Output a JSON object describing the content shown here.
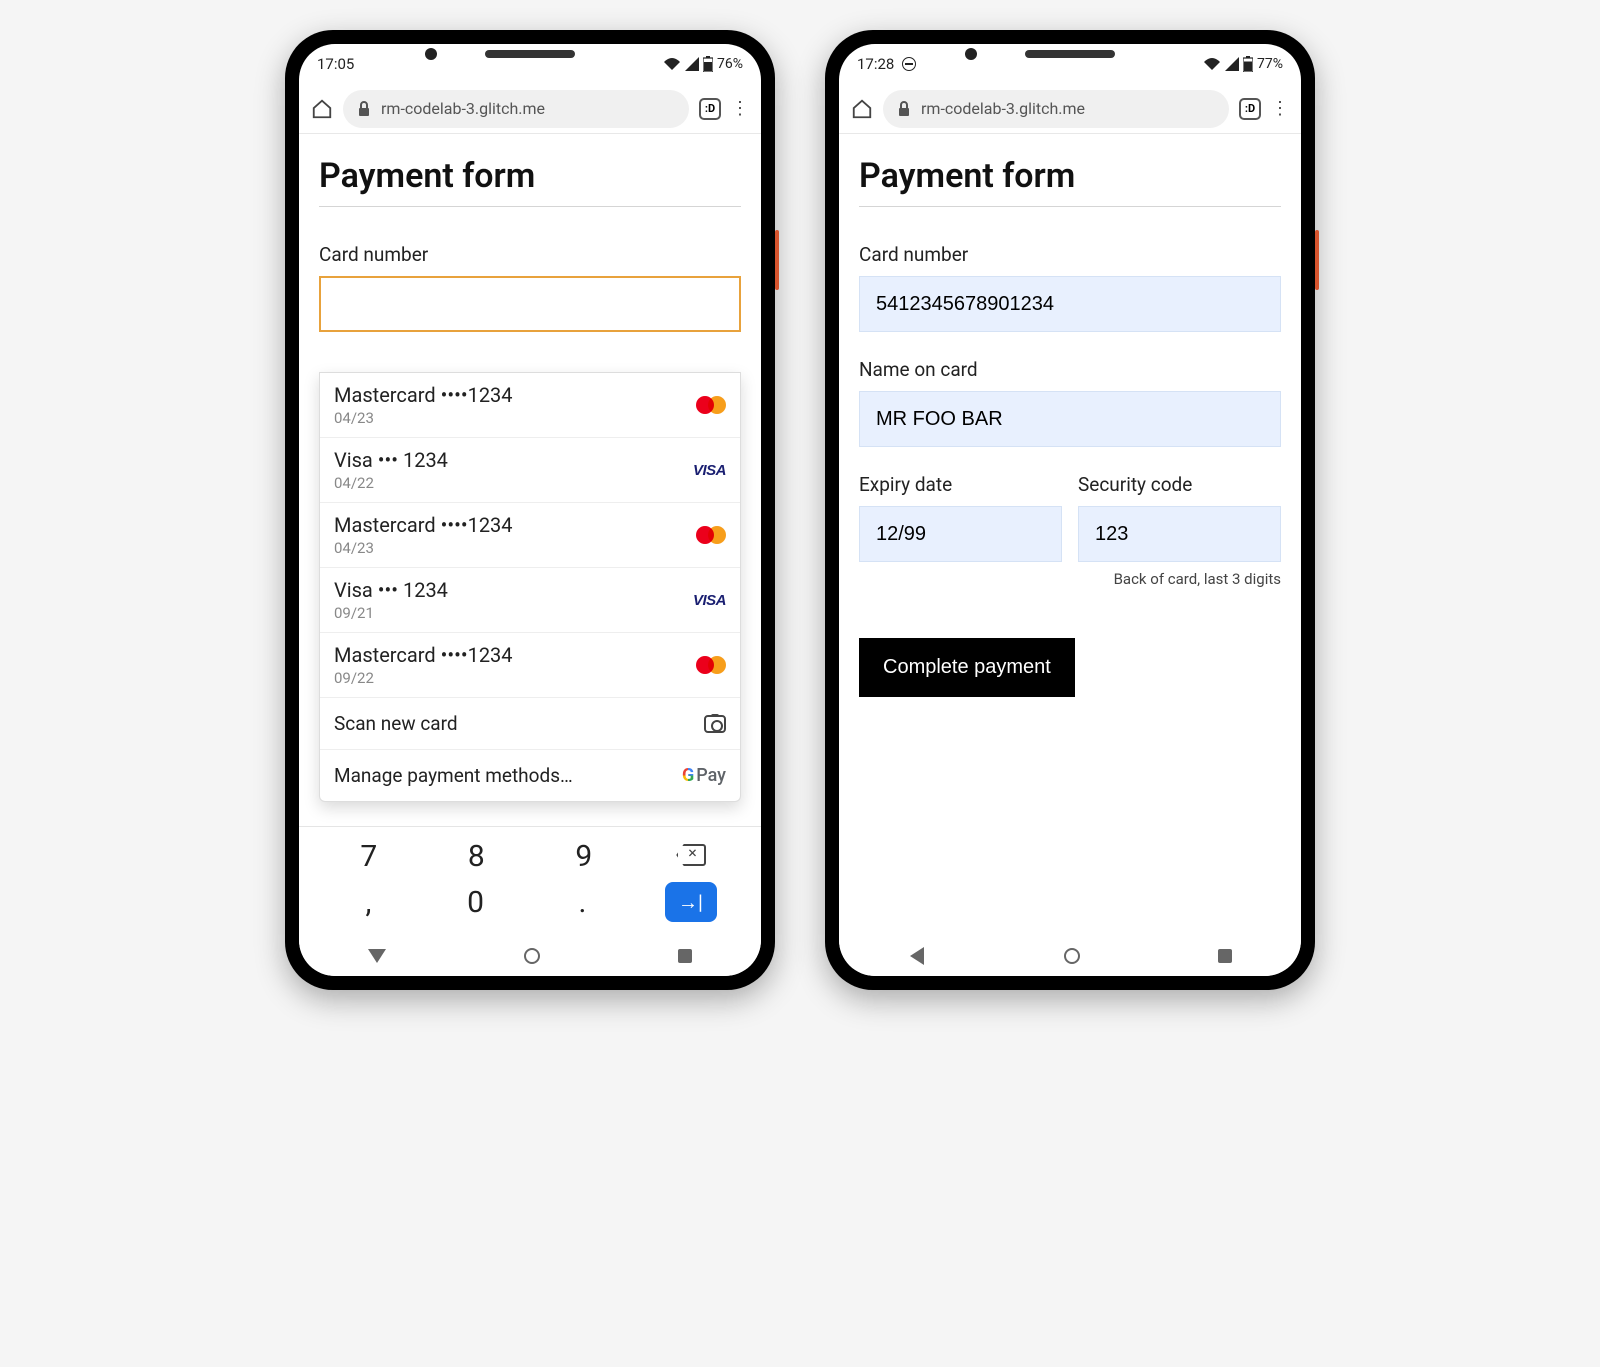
{
  "phone1": {
    "status": {
      "time": "17:05",
      "battery": "76%"
    },
    "browser": {
      "url": "rm-codelab-3.glitch.me",
      "tabcount": ":D"
    },
    "page_title": "Payment form",
    "card_label": "Card number",
    "autofill": {
      "cards": [
        {
          "brand": "Mastercard",
          "masked": "••••1234",
          "exp": "04/23",
          "type": "mastercard"
        },
        {
          "brand": "Visa",
          "masked": "••• 1234",
          "exp": "04/22",
          "type": "visa"
        },
        {
          "brand": "Mastercard",
          "masked": "••••1234",
          "exp": "04/23",
          "type": "mastercard"
        },
        {
          "brand": "Visa",
          "masked": "••• 1234",
          "exp": "09/21",
          "type": "visa"
        },
        {
          "brand": "Mastercard",
          "masked": "••••1234",
          "exp": "09/22",
          "type": "mastercard"
        }
      ],
      "scan_label": "Scan new card",
      "manage_label": "Manage payment methods…"
    },
    "keyboard": {
      "row1": [
        "7",
        "8",
        "9"
      ],
      "row2": [
        ",",
        "0",
        "."
      ]
    }
  },
  "phone2": {
    "status": {
      "time": "17:28",
      "battery": "77%"
    },
    "browser": {
      "url": "rm-codelab-3.glitch.me",
      "tabcount": ":D"
    },
    "page_title": "Payment form",
    "fields": {
      "card_label": "Card number",
      "card_value": "5412345678901234",
      "name_label": "Name on card",
      "name_value": "MR FOO BAR",
      "expiry_label": "Expiry date",
      "expiry_value": "12/99",
      "cvc_label": "Security code",
      "cvc_value": "123",
      "cvc_hint": "Back of card, last 3 digits"
    },
    "submit_label": "Complete payment"
  }
}
